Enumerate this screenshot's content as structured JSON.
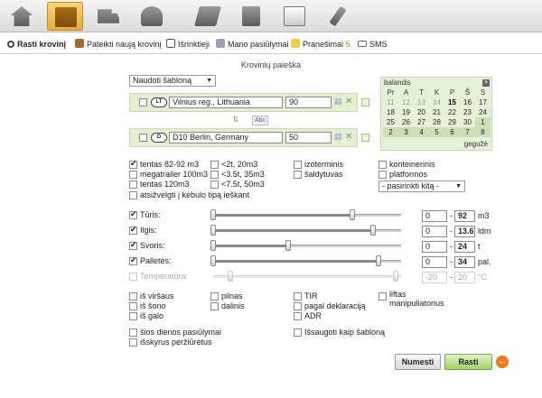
{
  "topbar": {
    "icons": [
      "home-icon",
      "cargo-boxes-icon",
      "truck-icon",
      "person-desk-icon",
      "map-icon",
      "books-icon",
      "newspaper-icon",
      "tools-icon"
    ]
  },
  "nav": {
    "search_cargo": "Rasti krovinį",
    "submit_cargo": "Pateikti naują krovinį",
    "saved": "Išrinktieji",
    "my_offers": "Mano pasiūlymai",
    "notifications": "Pranešimai",
    "notifications_count": "5",
    "sms": "SMS"
  },
  "page_title": "Krovinių paieška",
  "template_select": "Naudoti šabloną",
  "route": {
    "from": {
      "country": "LT",
      "place": "Vilnius reg., Lithuania",
      "radius": "90"
    },
    "abc": "Abc",
    "to": {
      "country": "D",
      "place": "D10 Berlin, Germany",
      "radius": "50"
    }
  },
  "calendar": {
    "month": "balandis",
    "close": "×",
    "weekdays": [
      "Pr",
      "A",
      "T",
      "K",
      "P",
      "Š",
      "S"
    ],
    "weeks": [
      [
        "11",
        "12",
        "13",
        "14",
        "15",
        "16",
        "17"
      ],
      [
        "18",
        "19",
        "20",
        "21",
        "22",
        "23",
        "24"
      ],
      [
        "25",
        "26",
        "27",
        "28",
        "29",
        "30",
        "1"
      ],
      [
        "2",
        "3",
        "4",
        "5",
        "6",
        "7",
        "8"
      ]
    ],
    "today": "15",
    "next": "gegužė"
  },
  "truck_types": {
    "col1": [
      "tentas 82-92 m3",
      "megatrailer 100m3",
      "tentas 120m3",
      "atsižvelgti į kėbulo tipą ieškant"
    ],
    "col2": [
      "<2t, 20m3",
      "<3.5t, 35m3",
      "<7.5t, 50m3"
    ],
    "col3": [
      "izoterminis",
      "šaldytuvas"
    ],
    "col4": [
      "konteinerinis",
      "platformos"
    ],
    "other_select": "- pasirinkti kitą -"
  },
  "ranges": [
    {
      "label": "Tūris:",
      "min": "0",
      "max": "92",
      "unit": "m3",
      "low": 0,
      "high": 0.74
    },
    {
      "label": "Ilgis:",
      "min": "0",
      "max": "13.6",
      "unit": "ldm",
      "low": 0,
      "high": 0.85
    },
    {
      "label": "Svoris:",
      "min": "0",
      "max": "24",
      "unit": "t",
      "low": 0,
      "high": 0.4
    },
    {
      "label": "Palletės:",
      "min": "0",
      "max": "34",
      "unit": "pal.",
      "low": 0,
      "high": 0.88
    },
    {
      "label": "Temperatūra:",
      "min": "-20",
      "max": "20",
      "unit": "°C",
      "low": 0.09,
      "high": 0.97
    }
  ],
  "options": {
    "col1": [
      "iš viršaus",
      "iš šono",
      "iš galo"
    ],
    "col2": [
      "pilnas",
      "dalinis"
    ],
    "col3": [
      "TIR",
      "pagal deklaraciją",
      "ADR"
    ],
    "col4": [
      "liftas",
      "manipuliatorius"
    ],
    "today_only": "šios dienos pasiūlymai",
    "hide_viewed": "išskyrus peržiūrėtus",
    "save_template": "Išsaugoti kaip šabloną"
  },
  "buttons": {
    "cancel": "Numesti",
    "search": "Rasti"
  }
}
